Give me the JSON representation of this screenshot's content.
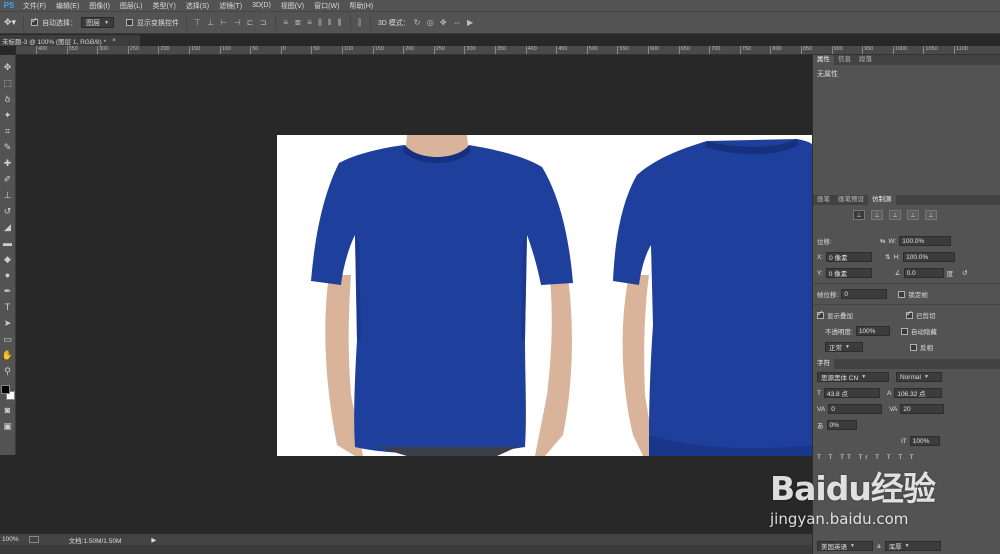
{
  "app": {
    "logo": "PS"
  },
  "menu": [
    "文件(F)",
    "编辑(E)",
    "图像(I)",
    "图层(L)",
    "类型(Y)",
    "选择(S)",
    "滤镜(T)",
    "3D(D)",
    "视图(V)",
    "窗口(W)",
    "帮助(H)"
  ],
  "options": {
    "auto_select_label": "自动选择：",
    "auto_select_value": "图层",
    "show_transform_label": "显示变换控件",
    "mode_3d_label": "3D 模式："
  },
  "document": {
    "tab_title": "未标题-3 @ 100% (图层 1, RGB/8) *",
    "close": "×"
  },
  "ruler": [
    "400",
    "350",
    "300",
    "250",
    "200",
    "150",
    "100",
    "50",
    "0",
    "50",
    "100",
    "150",
    "200",
    "250",
    "300",
    "350",
    "400",
    "450",
    "500",
    "550",
    "600",
    "650",
    "700",
    "750",
    "800",
    "850",
    "900",
    "950",
    "1000",
    "1050",
    "1100"
  ],
  "status": {
    "zoom": "100%",
    "doc_info": "文档:1.50M/1.50M",
    "arrow": "▶"
  },
  "properties_panel": {
    "tabs": [
      "属性",
      "信息",
      "段落"
    ],
    "no_properties": "无属性"
  },
  "control_panel": {
    "tabs": [
      "画笔",
      "画笔预设",
      "仿制源"
    ],
    "offset_label": "位移:",
    "x_label": "X:",
    "x_value": "0 像素",
    "y_label": "Y:",
    "y_value": "0 像素",
    "w_label": "W:",
    "w_value": "100.0%",
    "h_label": "H:",
    "h_value": "100.0%",
    "angle_value": "0.0",
    "angle_unit": "度",
    "frame_offset_label": "帧位移:",
    "frame_offset_value": "0",
    "lock_frame_label": "锁定帧",
    "show_overlay_label": "显示叠加",
    "opacity_label": "不透明度:",
    "opacity_value": "100%",
    "clipped_label": "已剪切",
    "auto_hide_label": "自动隐藏",
    "invert_label": "反相",
    "blend_mode": "正常"
  },
  "character_panel": {
    "tab": "字符",
    "font_family": "思源黑体 CN",
    "font_style": "Normal",
    "size_value": "43.8 点",
    "leading_value": "106.32 点",
    "kerning_value": "0",
    "tracking_value": "20",
    "scale_value": "0%",
    "vscale_value": "100%",
    "language": "美国英语",
    "aa_label": "a",
    "aa_value": "浑厚"
  },
  "watermark": {
    "logo": "Baidu经验",
    "url": "jingyan.baidu.com"
  },
  "colors": {
    "shirt": "#1e3f9c",
    "shirt_dark": "#15317e",
    "skin": "#d9b49a"
  }
}
